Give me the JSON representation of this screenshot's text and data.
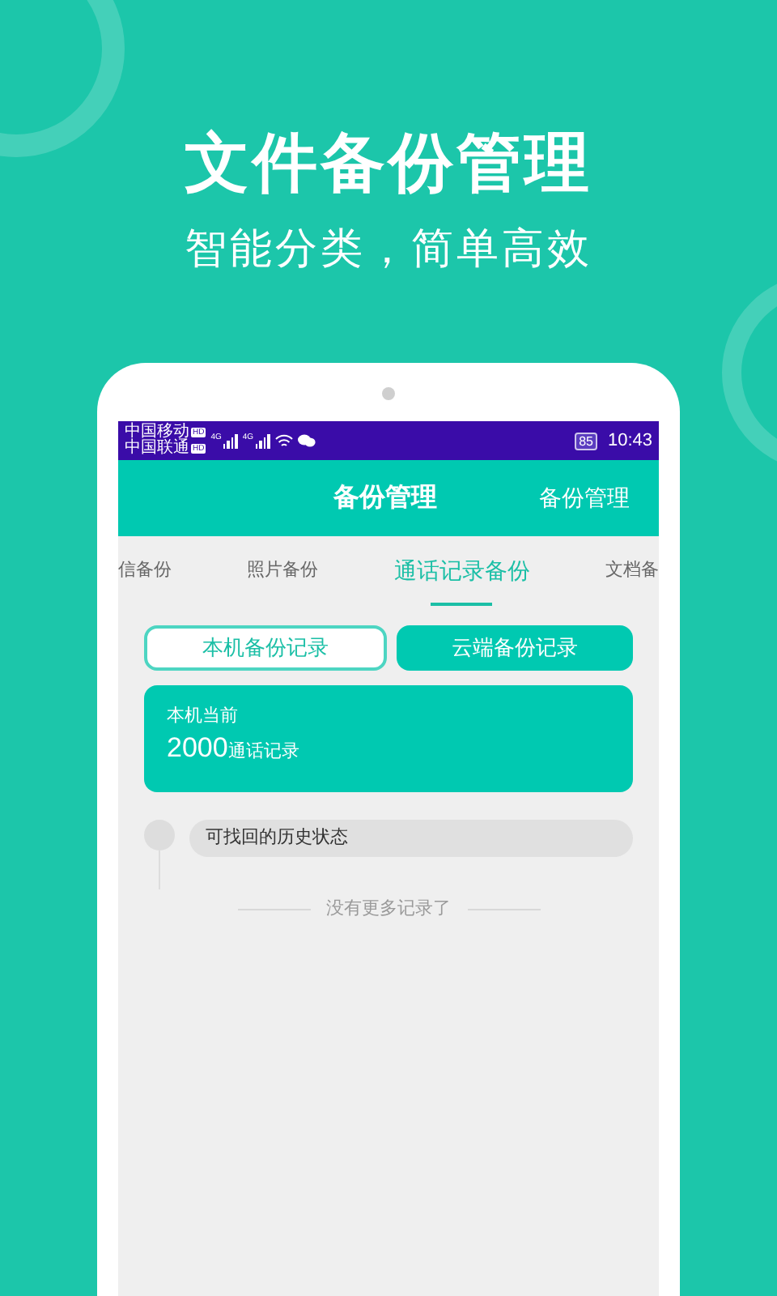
{
  "promo": {
    "title": "文件备份管理",
    "subtitle": "智能分类，简单高效"
  },
  "status_bar": {
    "carriers": [
      {
        "name": "中国移动",
        "badge": "HD"
      },
      {
        "name": "中国联通",
        "badge": "HD"
      }
    ],
    "signals": [
      "4G",
      "4G"
    ],
    "battery": "85",
    "time": "10:43"
  },
  "app_bar": {
    "title": "备份管理",
    "action": "备份管理"
  },
  "tabs": [
    {
      "label": "信备份",
      "selected": false
    },
    {
      "label": "照片备份",
      "selected": false
    },
    {
      "label": "通话记录备份",
      "selected": true
    },
    {
      "label": "文档备",
      "selected": false
    }
  ],
  "segments": [
    {
      "label": "本机备份记录",
      "selected": true
    },
    {
      "label": "云端备份记录",
      "selected": false
    }
  ],
  "summary": {
    "caption": "本机当前",
    "count": "2000",
    "unit": "通话记录"
  },
  "history": [
    {
      "label": "可找回的历史状态"
    }
  ],
  "end_note": "没有更多记录了"
}
